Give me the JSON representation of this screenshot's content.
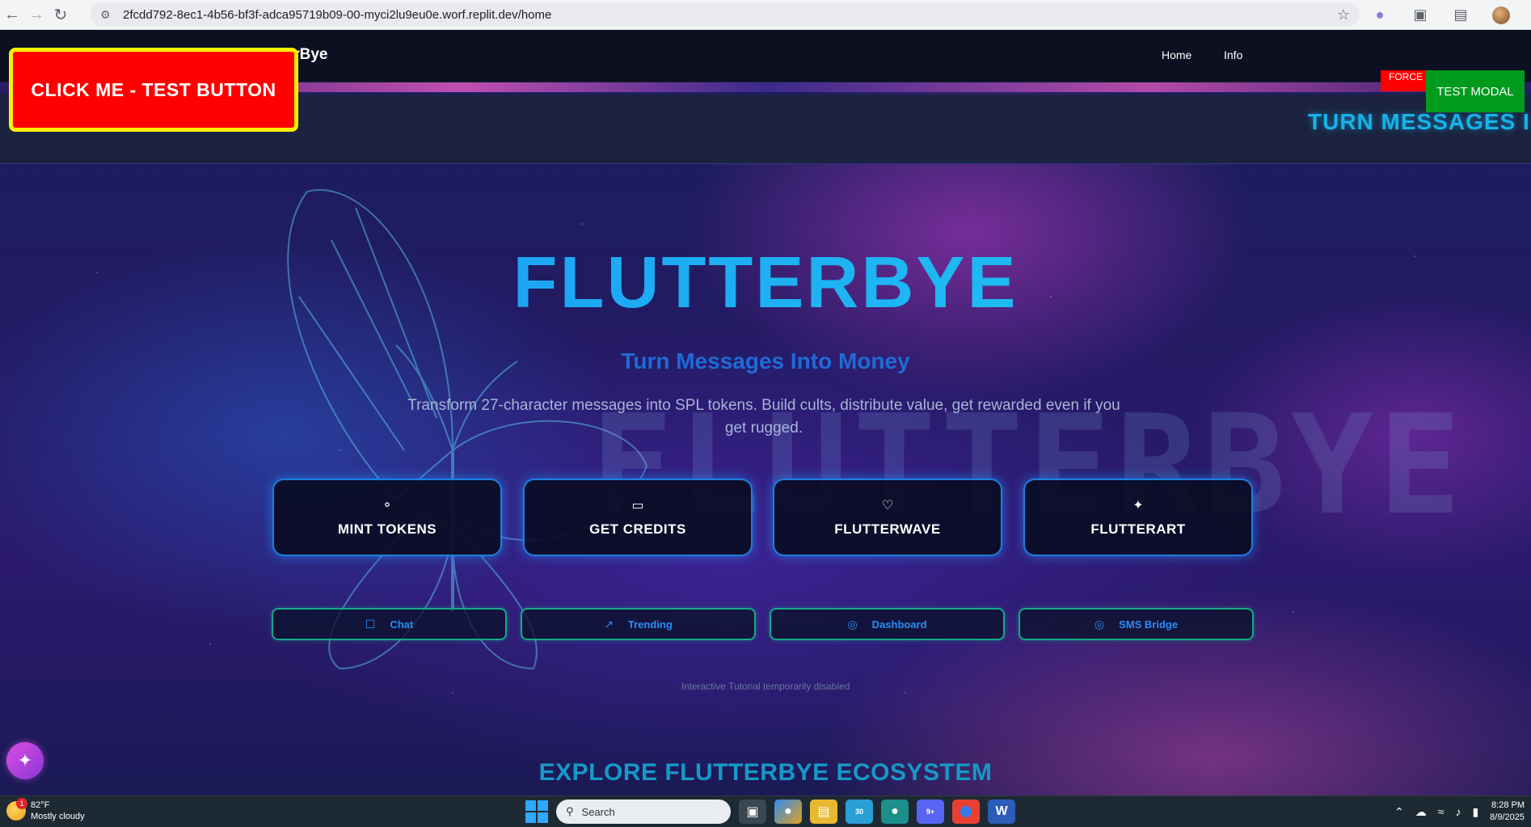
{
  "browser": {
    "url": "2fcdd792-8ec1-4b56-bf3f-adca95719b09-00-myci2lu9eu0e.worf.replit.dev/home"
  },
  "header": {
    "brand": "tterBye",
    "nav": [
      "Home",
      "Info"
    ]
  },
  "marquee": "TURN MESSAGES I",
  "overlays": {
    "test_button": "CLICK ME - TEST BUTTON",
    "force_button": "FORCE",
    "test_modal": "TEST MODAL"
  },
  "hero": {
    "title": "FLUTTERBYE",
    "subtitle": "Turn Messages Into Money",
    "description": "Transform 27-character messages into SPL tokens. Build cults, distribute value, get rewarded even if you get rugged."
  },
  "cards": [
    {
      "label": "MINT TOKENS",
      "icon": "coins-icon"
    },
    {
      "label": "GET CREDITS",
      "icon": "credit-card-icon"
    },
    {
      "label": "FLUTTERWAVE",
      "icon": "heart-icon"
    },
    {
      "label": "FLUTTERART",
      "icon": "sparkles-icon"
    }
  ],
  "actions": [
    {
      "label": "Chat",
      "icon": "chat-icon"
    },
    {
      "label": "Trending",
      "icon": "trending-icon"
    },
    {
      "label": "Dashboard",
      "icon": "target-icon"
    },
    {
      "label": "SMS Bridge",
      "icon": "microphone-icon"
    }
  ],
  "tutorial_note": "Interactive Tutorial temporarily disabled",
  "explore_heading": "EXPLORE FLUTTERBYE ECOSYSTEM",
  "watermark": "FLUTTERBYE",
  "taskbar": {
    "weather_badge": "1",
    "temperature": "82°F",
    "condition": "Mostly cloudy",
    "search_placeholder": "Search",
    "time": "8:28 PM",
    "date": "8/9/2025",
    "telegram_badge": "30",
    "discord_badge": "9+"
  },
  "colors": {
    "accent_blue": "#1fa6f5",
    "test_button_bg": "#ff0000",
    "test_modal_bg": "#009b1c",
    "card_border": "#1d7fe0",
    "action_border": "#16a98a"
  }
}
